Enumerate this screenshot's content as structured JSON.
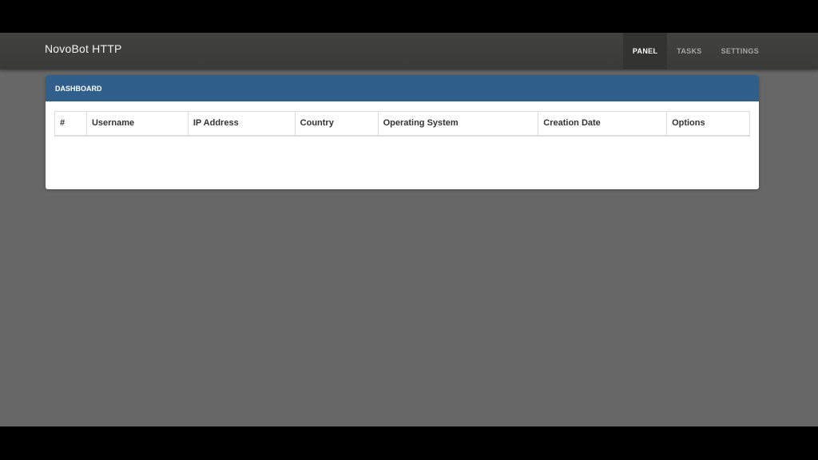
{
  "app": {
    "brand": "NovoBot HTTP"
  },
  "nav": {
    "items": [
      {
        "label": "PANEL",
        "active": true
      },
      {
        "label": "TASKS",
        "active": false
      },
      {
        "label": "SETTINGS",
        "active": false
      }
    ]
  },
  "card": {
    "title": "DASHBOARD"
  },
  "table": {
    "columns": [
      "#",
      "Username",
      "IP Address",
      "Country",
      "Operating System",
      "Creation Date",
      "Options"
    ],
    "rows": []
  },
  "colors": {
    "navbar": "#3e3e3c",
    "page_background": "#676767",
    "card_header": "#2f5f8a"
  }
}
